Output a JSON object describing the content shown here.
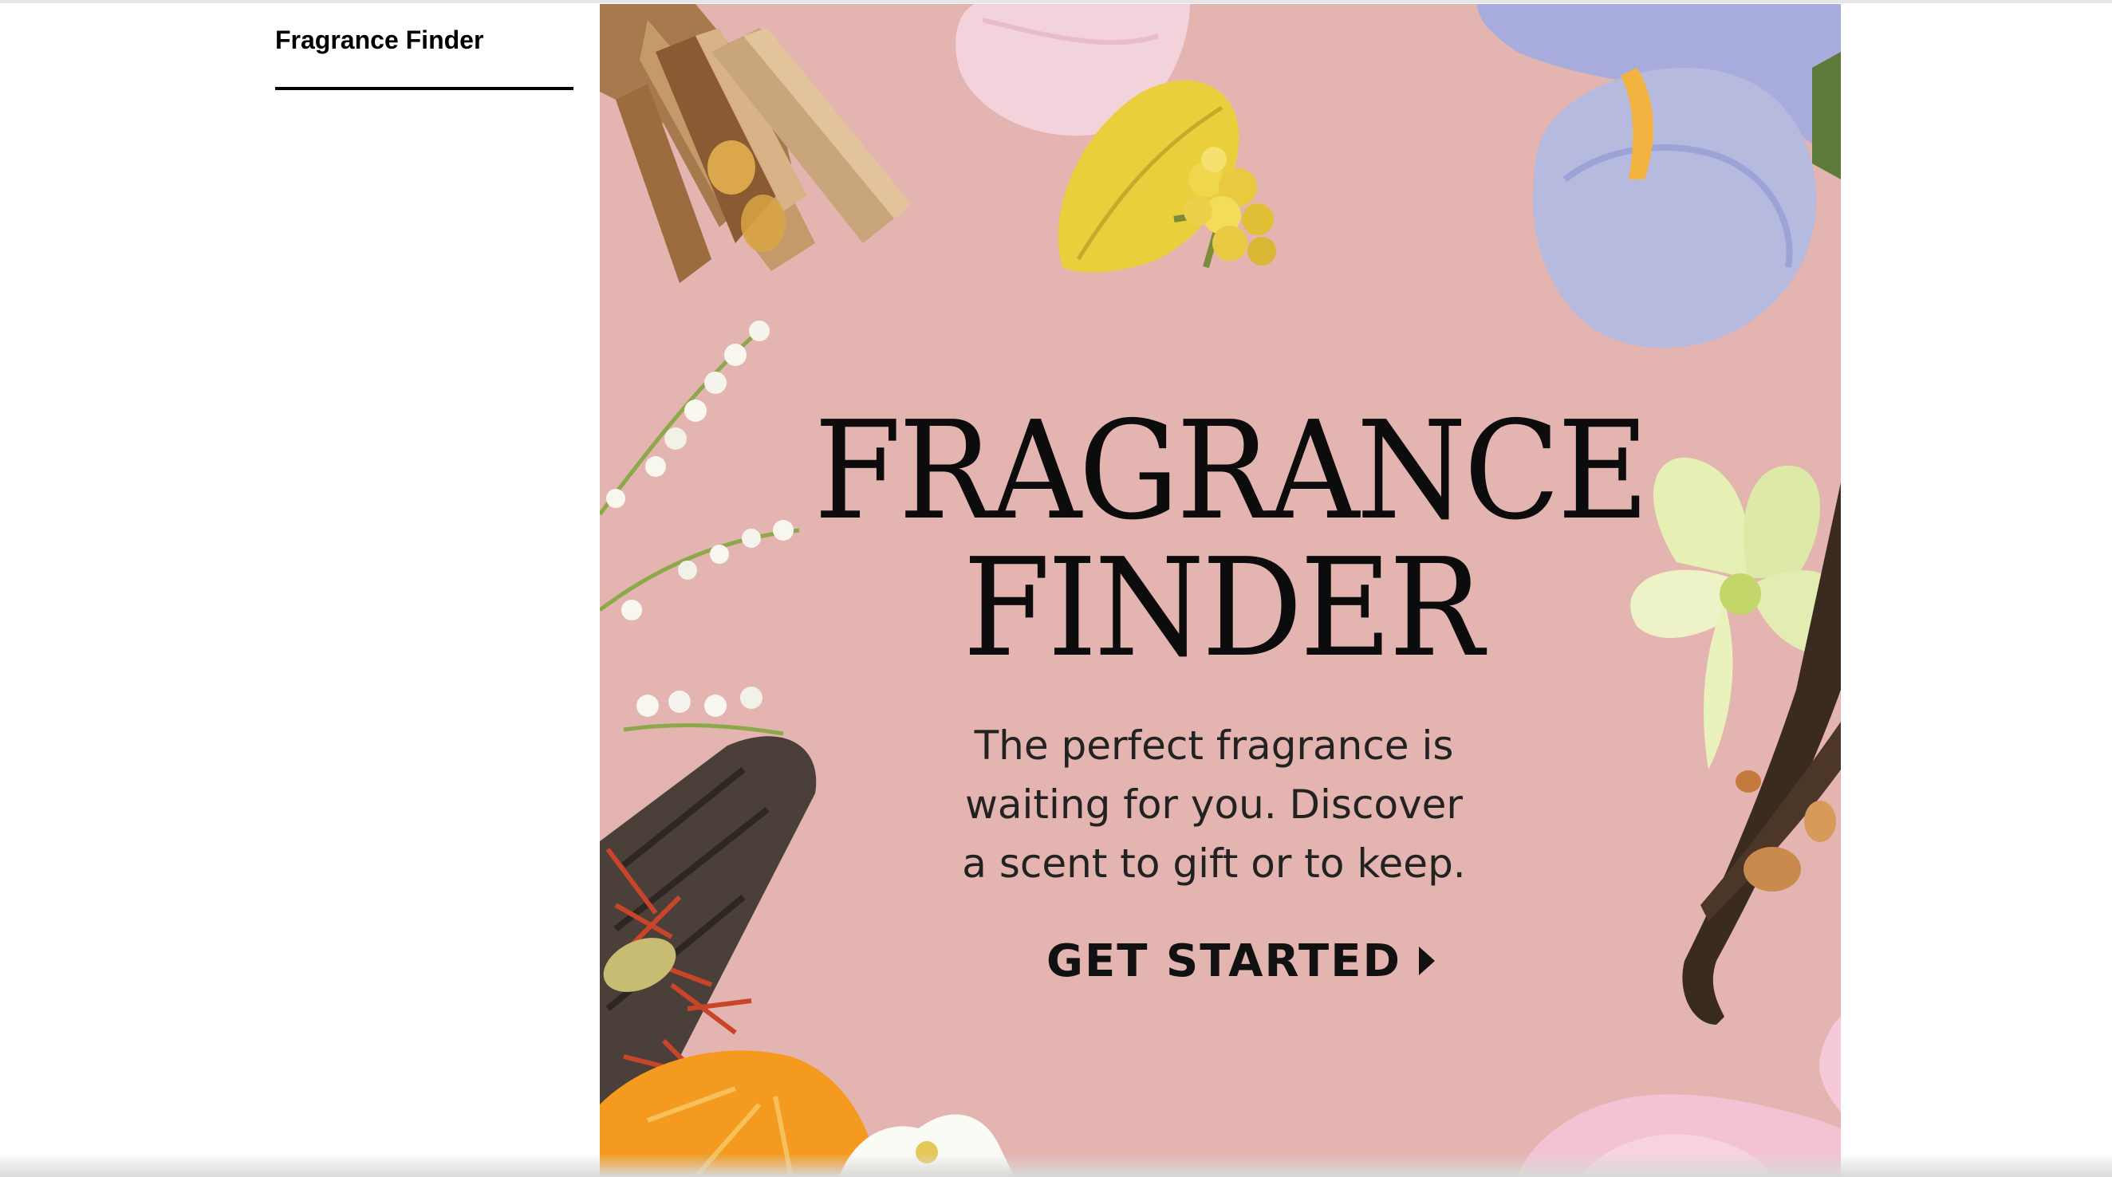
{
  "nav": {
    "active_tab_label": "Fragrance Finder"
  },
  "hero": {
    "title_line1": "FRAGRANCE",
    "title_line2": "FINDER",
    "copy_line1": "The perfect fragrance is",
    "copy_line2": "waiting for you. Discover",
    "copy_line3": "a scent to gift or to keep.",
    "cta_label": "GET STARTED",
    "background_color": "#e4b4b1",
    "decorations": [
      "cinnamon-sticks",
      "pink-petal",
      "yellow-petal",
      "mimosa-flower",
      "iris-flower",
      "lily-of-the-valley",
      "wood-chip",
      "saffron-threads",
      "cardamom-pod",
      "orange-slice",
      "jasmine-flower",
      "vanilla-orchid",
      "vanilla-pod",
      "amber-resin",
      "pink-rose"
    ]
  }
}
